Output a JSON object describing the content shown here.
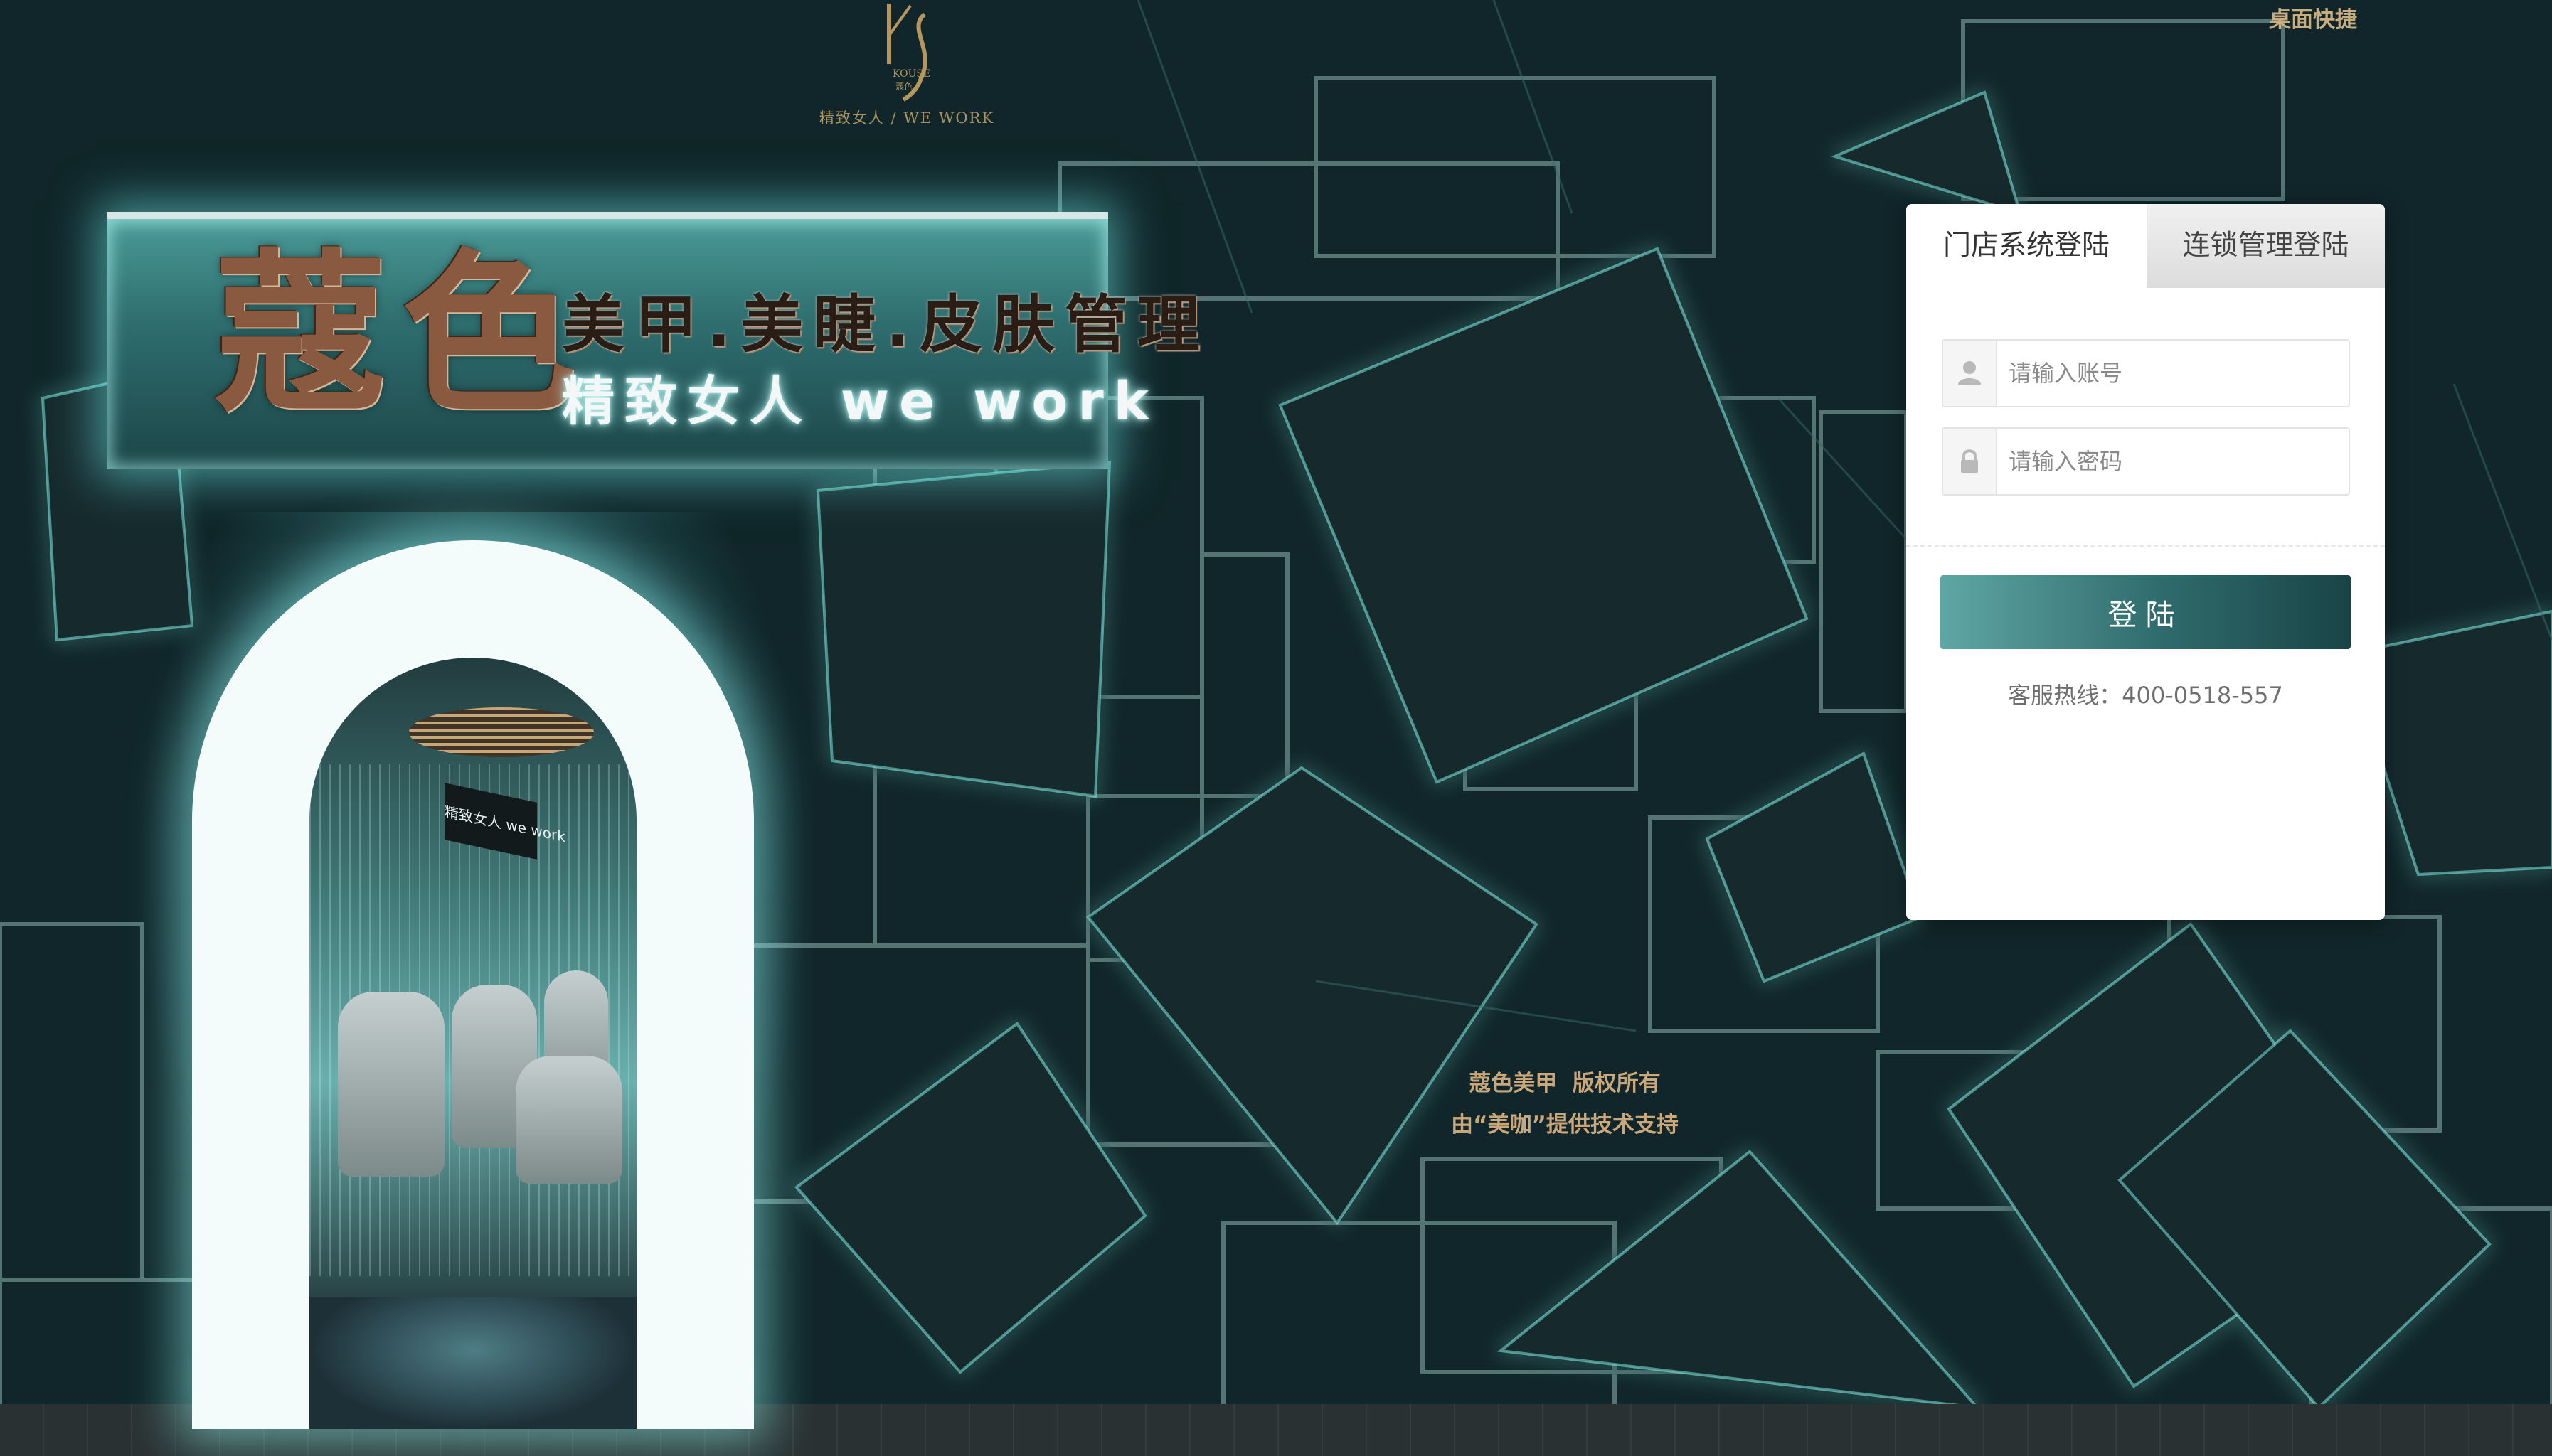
{
  "header": {
    "logo_letters": "KS",
    "logo_brand_en": "KOUSE",
    "logo_brand_cn": "蔻色",
    "logo_tagline": "精致女人 / WE WORK",
    "shortcut_label": "桌面快捷"
  },
  "storefront": {
    "brand": "蔻色",
    "line1": "美甲.美睫.皮肤管理",
    "line2": "精致女人 we work",
    "inner_sign": "精致女人 we work"
  },
  "login": {
    "tabs": [
      {
        "label": "门店系统登陆",
        "active": true
      },
      {
        "label": "连锁管理登陆",
        "active": false
      }
    ],
    "account_placeholder": "请输入账号",
    "password_placeholder": "请输入密码",
    "account_icon": "user-icon",
    "password_icon": "lock-icon",
    "submit_label": "登陆",
    "hotline": "客服热线：400-0518-557"
  },
  "footer": {
    "copyright": "蔻色美甲  版权所有",
    "support": "由“美咖”提供技术支持"
  },
  "colors": {
    "background": "#11272a",
    "accent_gold": "#c9a77a",
    "button_start": "#5fa7a4",
    "button_end": "#194446"
  }
}
